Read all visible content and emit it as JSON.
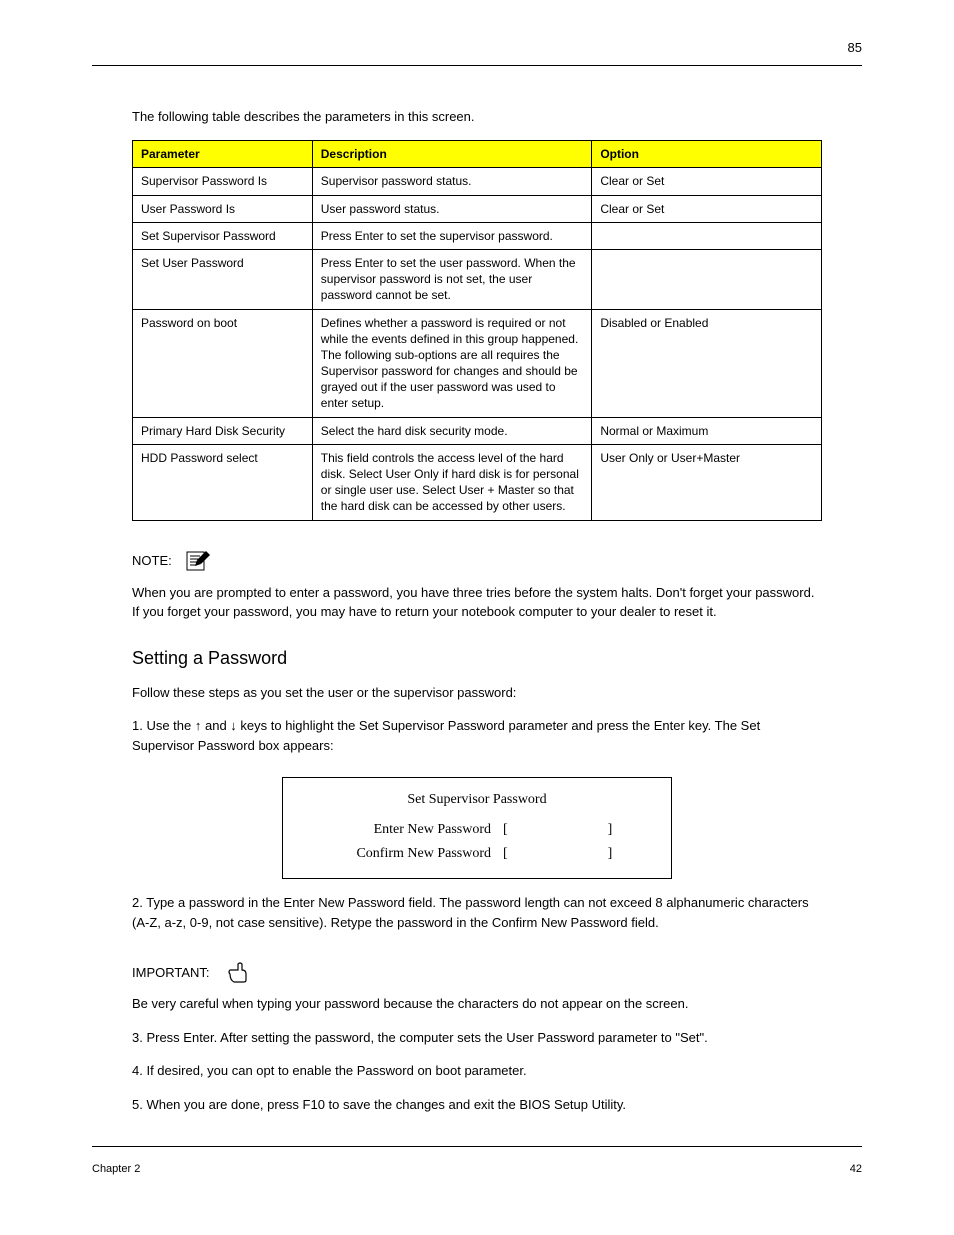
{
  "header": {
    "page_number": "85"
  },
  "intro": "The following table describes the parameters in this screen.",
  "table": {
    "headers": [
      "Parameter",
      "Description",
      "Option"
    ],
    "rows": [
      [
        "Supervisor Password Is",
        "Supervisor password status.",
        "Clear or Set"
      ],
      [
        "User Password Is",
        "User password status.",
        "Clear or Set"
      ],
      [
        "Set Supervisor Password",
        "Press Enter to set the supervisor password.",
        ""
      ],
      [
        "Set User Password",
        "Press Enter to set the user password. When the supervisor password is not set, the user password cannot be set.",
        ""
      ],
      [
        "Password on boot",
        "Defines whether a password is required or not while the events defined in this group happened. The following sub-options are all requires the Supervisor password for changes and should be grayed out if the user password was used to enter setup.",
        "Disabled or Enabled"
      ],
      [
        "Primary Hard Disk Security",
        "Select the hard disk security mode.",
        "Normal or Maximum"
      ],
      [
        "HDD Password select",
        "This field controls the access level of the hard disk. Select User Only if hard disk is for personal or single user use. Select User + Master so that the hard disk can be accessed by other users.",
        "User Only or User+Master"
      ]
    ]
  },
  "note": {
    "label": "NOTE:",
    "body": "When you are prompted to enter a password, you have three tries before the system halts. Don't forget your password. If you forget your password, you may have to return your notebook computer to your dealer to reset it."
  },
  "subhead": "Setting a Password",
  "para": "Follow these steps as you set the user or the supervisor password:",
  "step": "1. Use the ↑ and ↓ keys to highlight the Set Supervisor Password parameter and press the Enter key. The Set Supervisor Password box appears:",
  "dialog": {
    "title": "Set Supervisor Password",
    "row1_label": "Enter New Password",
    "row2_label": "Confirm New Password",
    "lb": "[",
    "rb": "]"
  },
  "step2": "2. Type a password in the Enter New Password field. The password length can not exceed 8 alphanumeric characters (A-Z, a-z, 0-9, not case sensitive). Retype the password in the Confirm New Password field.",
  "important": {
    "label": "IMPORTANT:",
    "body": "Be very careful when typing your password because the characters do not appear on the screen."
  },
  "step3": "3. Press Enter. After setting the password, the computer sets the User Password parameter to \"Set\".",
  "step4": "4. If desired, you can opt to enable the Password on boot parameter.",
  "step5": "5. When you are done, press F10 to save the changes and exit the BIOS Setup Utility.",
  "footer": {
    "left": "Chapter 2",
    "right": "42"
  }
}
